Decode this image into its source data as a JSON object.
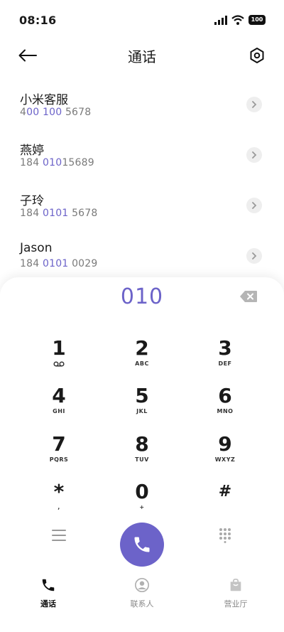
{
  "status_bar": {
    "time": "08:16",
    "battery": "100"
  },
  "header": {
    "title": "通话"
  },
  "contacts": [
    {
      "name": "小米客服",
      "number_prefix": "4",
      "number_match": "00 100",
      "number_suffix": " 5678"
    },
    {
      "name": "燕婷",
      "number_prefix": "184 ",
      "number_match": "010",
      "number_suffix": "15689"
    },
    {
      "name": "子玲",
      "number_prefix": "184 ",
      "number_match": "0101",
      "number_suffix": " 5678"
    },
    {
      "name": "Jason",
      "number_prefix": "184 ",
      "number_match": "0101",
      "number_suffix": " 0029"
    }
  ],
  "dialpad": {
    "entered_number": "010",
    "keys": [
      {
        "digit": "1",
        "letters": ""
      },
      {
        "digit": "2",
        "letters": "ABC"
      },
      {
        "digit": "3",
        "letters": "DEF"
      },
      {
        "digit": "4",
        "letters": "GHI"
      },
      {
        "digit": "5",
        "letters": "JKL"
      },
      {
        "digit": "6",
        "letters": "MNO"
      },
      {
        "digit": "7",
        "letters": "PQRS"
      },
      {
        "digit": "8",
        "letters": "TUV"
      },
      {
        "digit": "9",
        "letters": "WXYZ"
      },
      {
        "digit": "*",
        "letters": ","
      },
      {
        "digit": "0",
        "letters": "+"
      },
      {
        "digit": "#",
        "letters": ""
      }
    ]
  },
  "bottom_nav": {
    "items": [
      {
        "label": "通话",
        "icon": "phone-icon",
        "active": true
      },
      {
        "label": "联系人",
        "icon": "contact-icon",
        "active": false
      },
      {
        "label": "营业厅",
        "icon": "shop-bag-icon",
        "active": false
      }
    ]
  },
  "colors": {
    "accent": "#6c63c9",
    "text": "#1a1a1a",
    "secondary": "#7a7a7a"
  }
}
